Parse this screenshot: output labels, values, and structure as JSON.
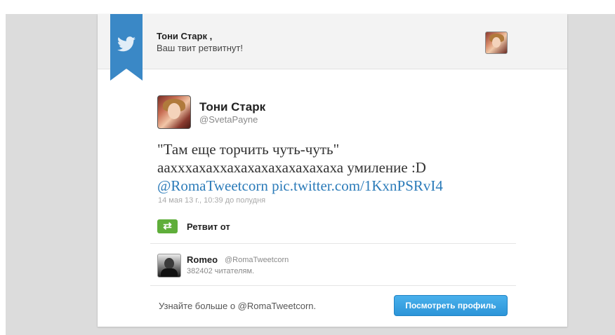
{
  "header": {
    "name": "Тони Старк ,",
    "subtitle": "Ваш твит ретвитнут!"
  },
  "tweet": {
    "author_name": "Тони Старк",
    "author_handle": "@SvetaPayne",
    "text_line1": "\"Там еще торчить чуть-чуть\"",
    "text_line2": "аахххахаххахахахахахахахаха умиление :D",
    "mention": "@RomaTweetcorn",
    "pic_link": "pic.twitter.com/1KxnPSRvI4",
    "date": "14 мая 13 г., 10:39 до полудня"
  },
  "retweet": {
    "label": "Ретвит от",
    "icon_glyph": "⇄",
    "user_name": "Romeo",
    "user_handle": "@RomaTweetcorn",
    "followers": "382402 читателям."
  },
  "footer": {
    "learn_more": "Узнайте больше о @RomaTweetcorn.",
    "profile_button": "Посмотреть профиль"
  },
  "colors": {
    "ribbon": "#3a88c6",
    "link": "#2b7bb9",
    "retweet_green": "#5fae3a",
    "button": "#2c95d8"
  }
}
